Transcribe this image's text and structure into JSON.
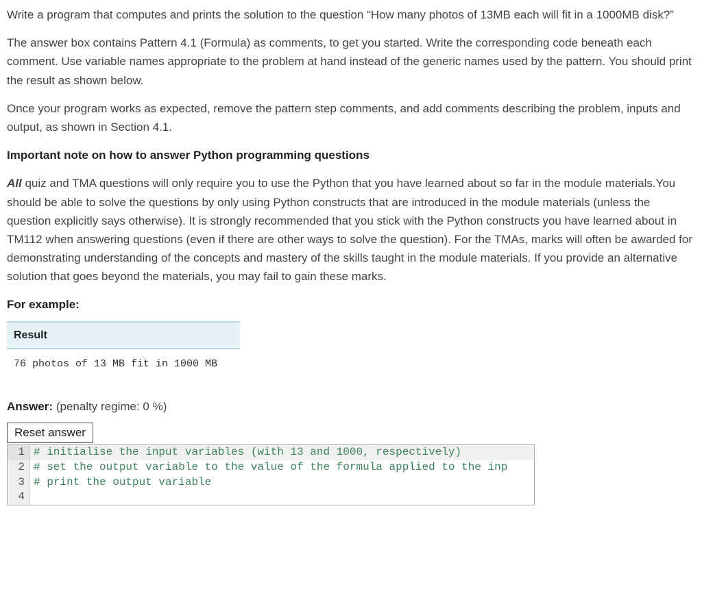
{
  "paragraphs": {
    "p1": "Write a program that computes and prints the solution to the question “How many photos of 13MB each will fit in a 1000MB disk?”",
    "p2": "The answer box contains Pattern 4.1 (Formula) as comments, to get you started. Write the corresponding code beneath each comment. Use variable names appropriate to the problem at hand instead of the generic names used by the pattern. You should print the result as shown below.",
    "p3": "Once your program works as expected, remove the pattern step comments, and add comments describing the problem, inputs and output, as shown in Section 4.1.",
    "note_heading": "Important note on how to answer Python programming questions",
    "p4_prefix": "All",
    "p4_rest": " quiz and TMA questions will only require you to use the Python that you have learned about so far in the module materials.You should be able to solve the questions by only using Python constructs that are introduced in the module materials (unless the question explicitly says otherwise). It is strongly recommended that you stick with the Python constructs you have learned about in TM112 when answering questions (even if there are other ways to solve the question). For the TMAs, marks will often be awarded for demonstrating understanding of the concepts and mastery of the skills taught in the module materials. If you provide an alternative solution that goes beyond the materials, you may fail to gain these marks.",
    "for_example": "For example:"
  },
  "result_table": {
    "header": "Result",
    "output": "76 photos of 13 MB fit in 1000 MB"
  },
  "answer": {
    "label": "Answer:",
    "penalty": "(penalty regime: 0 %)",
    "reset_btn": "Reset answer"
  },
  "code": {
    "lines": [
      "# initialise the input variables (with 13 and 1000, respectively)",
      "# set the output variable to the value of the formula applied to the inp",
      "# print the output variable",
      ""
    ]
  }
}
